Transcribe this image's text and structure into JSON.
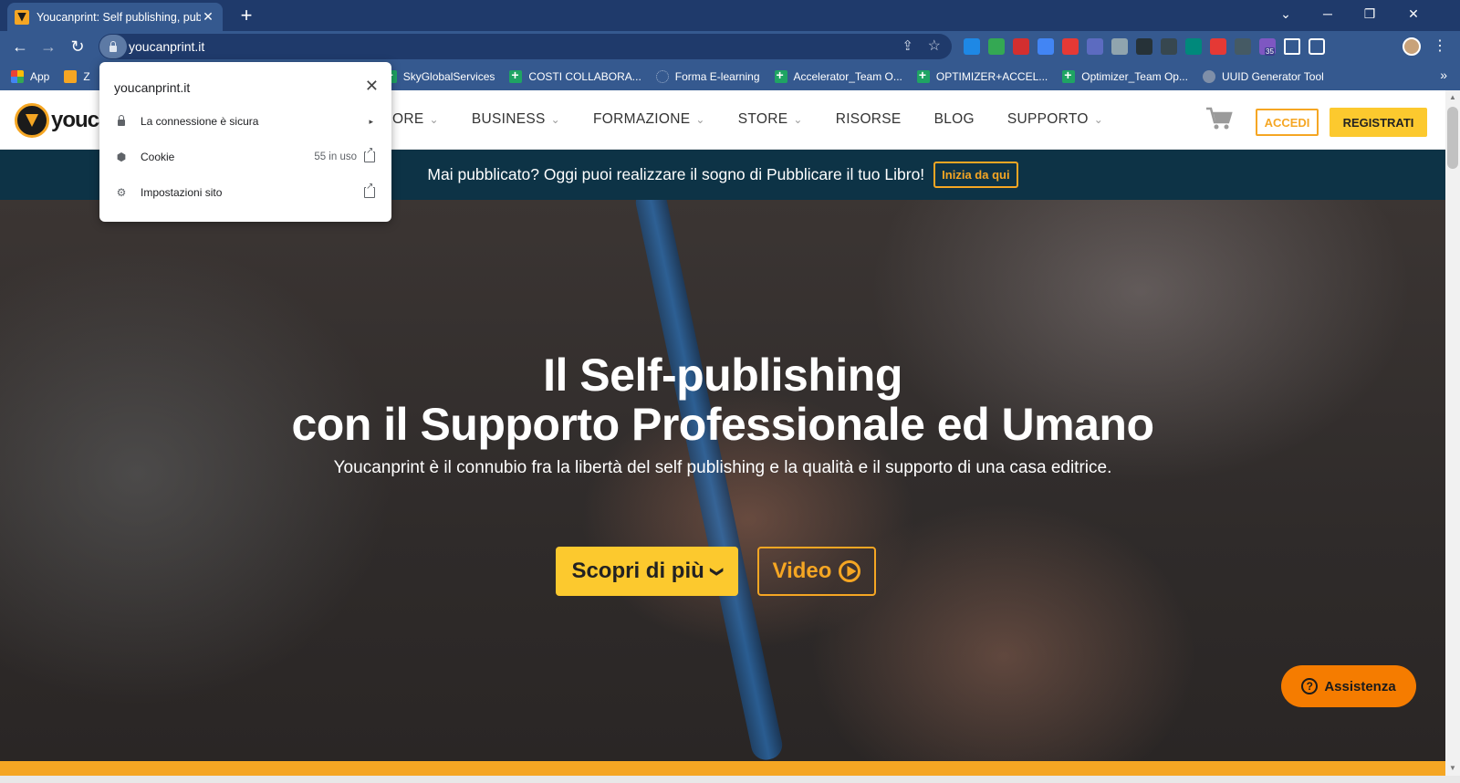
{
  "browser": {
    "tab_title": "Youcanprint: Self publishing, pub",
    "tab_close": "✕",
    "new_tab": "+",
    "window_minimize": "─",
    "window_restore": "❐",
    "window_close": "✕",
    "back": "←",
    "forward": "→",
    "reload": "↻",
    "url": "youcanprint.it",
    "share_icon": "⇪",
    "star_icon": "☆",
    "kebab": "⋮",
    "extension_badge": "35",
    "extension_colors": [
      "#1e88e5",
      "#34a853",
      "#d32f2f",
      "#4285f4",
      "#e53935",
      "#5c6bc0",
      "#90a4ae",
      "#263238",
      "#37474f",
      "#00897b",
      "#e53935",
      "#455a64",
      "#7e57c2",
      "#eeeeee",
      "#ffffff"
    ]
  },
  "bookmarks": {
    "items": [
      {
        "label": "App",
        "icon": "apps-icon"
      },
      {
        "label": "Z",
        "icon": "bookmark-icon"
      },
      {
        "label": "SkyGlobalServices",
        "icon": "sheets-icon"
      },
      {
        "label": "COSTI COLLABORA...",
        "icon": "sheets-icon"
      },
      {
        "label": "Forma E-learning",
        "icon": "dots-icon"
      },
      {
        "label": "Accelerator_Team O...",
        "icon": "sheets-icon"
      },
      {
        "label": "OPTIMIZER+ACCEL...",
        "icon": "sheets-icon"
      },
      {
        "label": "Optimizer_Team Op...",
        "icon": "sheets-icon"
      },
      {
        "label": "UUID Generator Tool",
        "icon": "globe-icon"
      }
    ],
    "more": "»"
  },
  "popup": {
    "domain": "youcanprint.it",
    "close": "✕",
    "connection": "La connessione è sicura",
    "connection_arrow": "▸",
    "cookie_label": "Cookie",
    "cookie_count": "55 in uso",
    "cookie_icon": "⬢",
    "settings_label": "Impostazioni sito",
    "settings_icon": "⚙"
  },
  "site": {
    "logo_text": "youca",
    "nav": [
      {
        "label": "ORE",
        "dropdown": true
      },
      {
        "label": "BUSINESS",
        "dropdown": true
      },
      {
        "label": "FORMAZIONE",
        "dropdown": true
      },
      {
        "label": "STORE",
        "dropdown": true
      },
      {
        "label": "RISORSE",
        "dropdown": false
      },
      {
        "label": "BLOG",
        "dropdown": false
      },
      {
        "label": "SUPPORTO",
        "dropdown": true
      }
    ],
    "chevron": "⌄",
    "accedi": "ACCEDI",
    "registrati": "REGISTRATI",
    "promo_text": "Mai pubblicato? Oggi puoi realizzare il sogno di Pubblicare il tuo Libro!",
    "promo_cta": "Inizia da qui",
    "hero_line1": "Il Self-publishing",
    "hero_line2": "con il Supporto Professionale ed Umano",
    "hero_sub": "Youcanprint è il connubio fra la libertà del self publishing e la qualità e il supporto di una casa editrice.",
    "btn_scopri": "Scopri di più",
    "btn_scopri_chevron": "❯",
    "btn_video": "Video",
    "assist_label": "Assistenza",
    "assist_q": "?",
    "colors": {
      "accent": "#f5a623",
      "yellow": "#fcc92e",
      "promo_bg": "#0d3346",
      "assist": "#f57c00"
    }
  },
  "scrollbar": {
    "up": "▲",
    "down": "▼"
  }
}
